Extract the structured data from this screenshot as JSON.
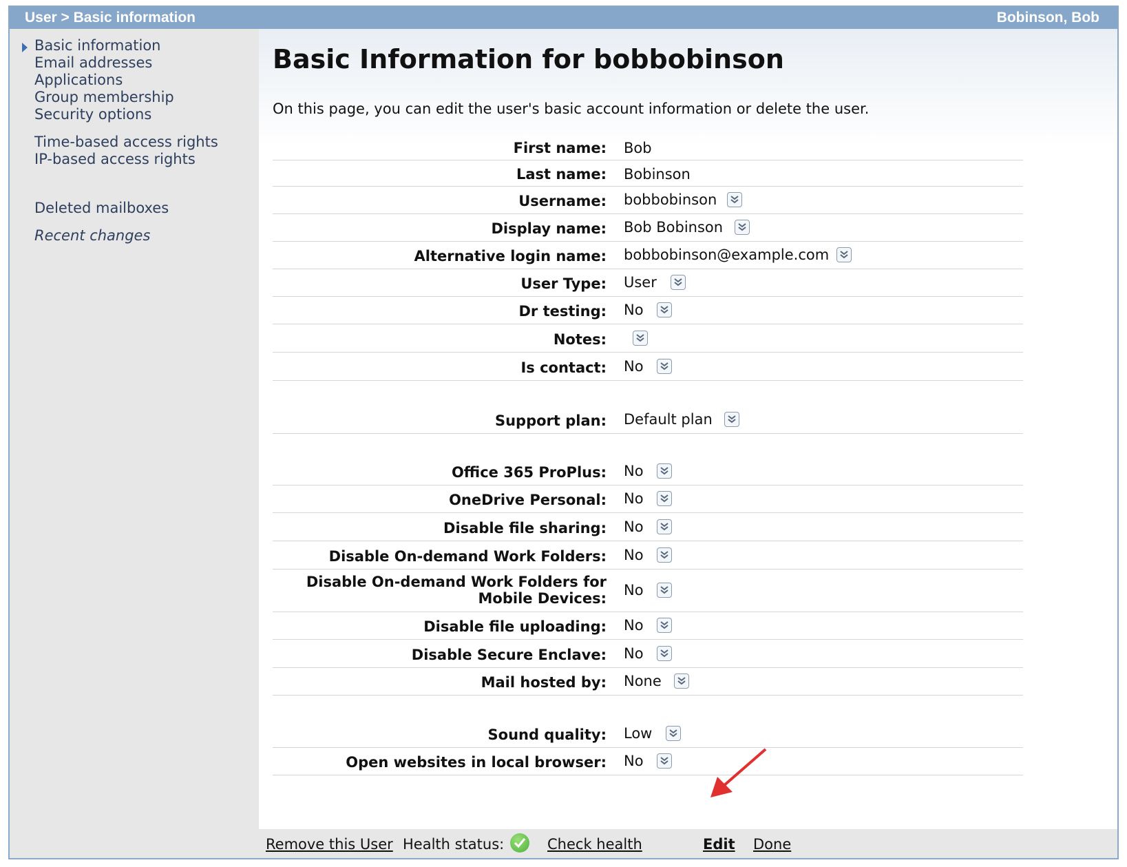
{
  "header": {
    "breadcrumb": "User > Basic information",
    "user_name": "Bobinson, Bob"
  },
  "sidebar": {
    "items": [
      {
        "label": "Basic information",
        "active": true
      },
      {
        "label": "Email addresses"
      },
      {
        "label": "Applications"
      },
      {
        "label": "Group membership"
      },
      {
        "label": "Security options"
      },
      {
        "label": "Time-based access rights"
      },
      {
        "label": "IP-based access rights"
      },
      {
        "label": "Deleted mailboxes"
      },
      {
        "label": "Recent changes"
      }
    ]
  },
  "main": {
    "title": "Basic Information for bobbobinson",
    "intro": "On this page, you can edit the user's basic account information or delete the user.",
    "fields": [
      {
        "label": "First name:",
        "value": "Bob"
      },
      {
        "label": "Last name:",
        "value": "Bobinson"
      },
      {
        "label": "Username:",
        "value": "bobbobinson"
      },
      {
        "label": "Display name:",
        "value": "Bob Bobinson"
      },
      {
        "label": "Alternative login name:",
        "value": "bobbobinson@example.com"
      },
      {
        "label": "User Type:",
        "value": "User"
      },
      {
        "label": "Dr testing:",
        "value": "No"
      },
      {
        "label": "Notes:",
        "value": ""
      },
      {
        "label": "Is contact:",
        "value": "No"
      },
      {
        "label": "Support plan:",
        "value": "Default plan"
      },
      {
        "label": "Office 365 ProPlus:",
        "value": "No"
      },
      {
        "label": "OneDrive Personal:",
        "value": "No"
      },
      {
        "label": "Disable file sharing:",
        "value": "No"
      },
      {
        "label": "Disable On-demand Work Folders:",
        "value": "No"
      },
      {
        "label": "Disable On-demand Work Folders for Mobile Devices:",
        "value": "No"
      },
      {
        "label": "Disable file uploading:",
        "value": "No"
      },
      {
        "label": "Disable Secure Enclave:",
        "value": "No"
      },
      {
        "label": "Mail hosted by:",
        "value": "None"
      },
      {
        "label": "Sound quality:",
        "value": "Low"
      },
      {
        "label": "Open websites in local browser:",
        "value": "No"
      }
    ]
  },
  "footer": {
    "remove_label": "Remove this User",
    "health_label": "Health status:",
    "check_health_label": "Check health",
    "edit_label": "Edit",
    "done_label": "Done"
  },
  "colors": {
    "header_bg": "#86a7c9",
    "sidebar_bg": "#e7e7e7",
    "annotation_arrow": "#e03030"
  },
  "icons": {
    "dropdown": "double-chevron-down-icon",
    "health": "green-check-icon",
    "nav_active": "triangle-right-icon"
  }
}
